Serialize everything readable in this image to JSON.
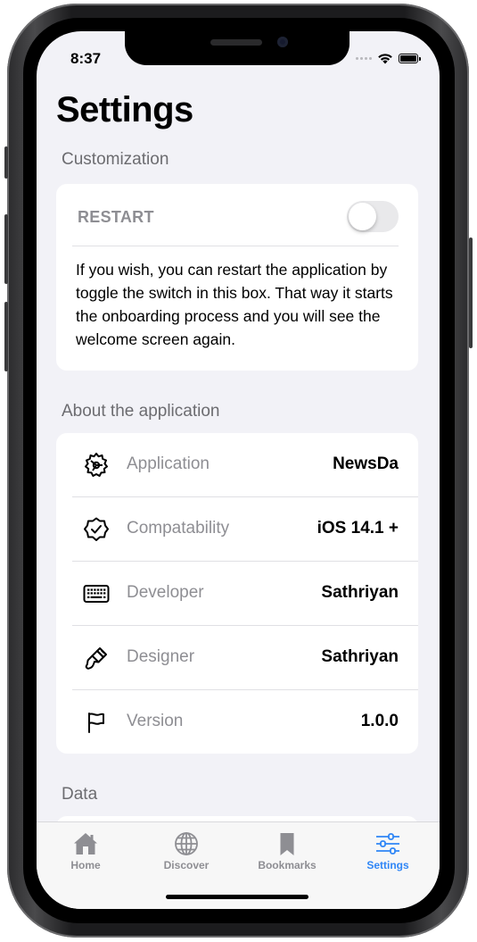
{
  "status_bar": {
    "time": "8:37"
  },
  "page": {
    "title": "Settings"
  },
  "customization": {
    "header": "Customization",
    "restart_title": "RESTART",
    "restart_toggle_on": false,
    "restart_description": "If you wish, you can restart the application by toggle the switch in this box. That way it starts the onboarding process and you will see the welcome screen again."
  },
  "about": {
    "header": "About the application",
    "rows": [
      {
        "icon": "gear-icon",
        "label": "Application",
        "value": "NewsDa"
      },
      {
        "icon": "checkmark-seal-icon",
        "label": "Compatability",
        "value": "iOS 14.1 +"
      },
      {
        "icon": "keyboard-icon",
        "label": "Developer",
        "value": "Sathriyan"
      },
      {
        "icon": "paintbrush-icon",
        "label": "Designer",
        "value": "Sathriyan"
      },
      {
        "icon": "flag-icon",
        "label": "Version",
        "value": "1.0.0"
      }
    ]
  },
  "data_section": {
    "header": "Data"
  },
  "tab_bar": {
    "tabs": [
      {
        "icon": "house-icon",
        "label": "Home",
        "active": false
      },
      {
        "icon": "globe-icon",
        "label": "Discover",
        "active": false
      },
      {
        "icon": "bookmark-icon",
        "label": "Bookmarks",
        "active": false
      },
      {
        "icon": "sliders-icon",
        "label": "Settings",
        "active": true
      }
    ]
  },
  "colors": {
    "accent": "#2f86f6",
    "background": "#f2f2f7",
    "secondary_text": "#8e8e93"
  }
}
